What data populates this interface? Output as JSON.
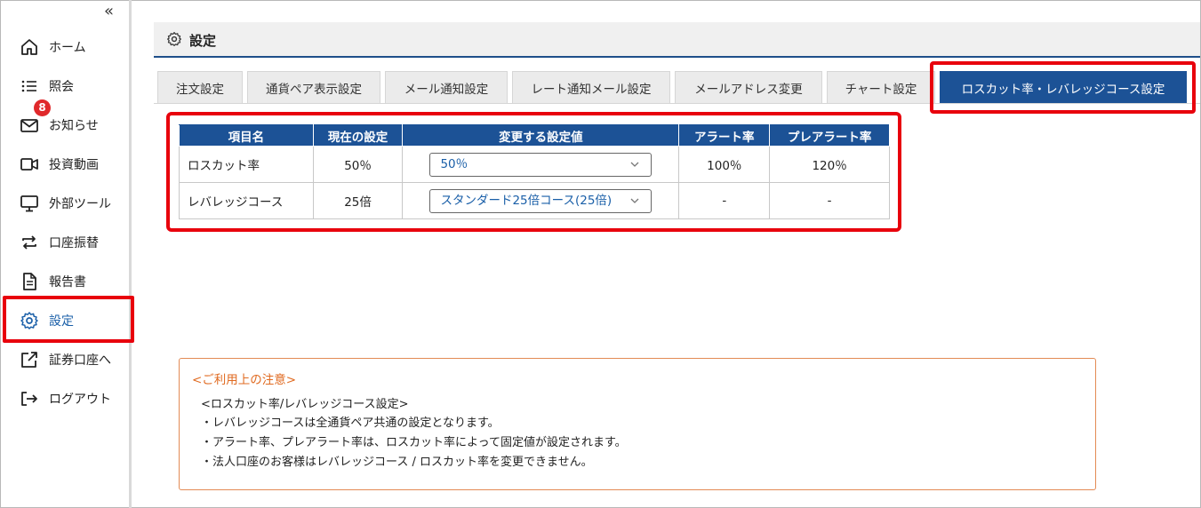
{
  "sidebar": {
    "collapse_icon": "double-chevron-left",
    "items": [
      {
        "label": "ホーム",
        "icon": "home-icon"
      },
      {
        "label": "照会",
        "icon": "list-icon"
      },
      {
        "label": "お知らせ",
        "icon": "mail-icon",
        "badge": "8"
      },
      {
        "label": "投資動画",
        "icon": "video-icon"
      },
      {
        "label": "外部ツール",
        "icon": "monitor-icon"
      },
      {
        "label": "口座振替",
        "icon": "transfer-icon"
      },
      {
        "label": "報告書",
        "icon": "document-icon"
      },
      {
        "label": "設定",
        "icon": "gear-icon",
        "active": true
      },
      {
        "label": "証券口座へ",
        "icon": "external-link-icon"
      },
      {
        "label": "ログアウト",
        "icon": "logout-icon"
      }
    ]
  },
  "page": {
    "title": "設定",
    "title_icon": "gear-icon"
  },
  "tabs": [
    {
      "label": "注文設定"
    },
    {
      "label": "通貨ペア表示設定"
    },
    {
      "label": "メール通知設定"
    },
    {
      "label": "レート通知メール設定"
    },
    {
      "label": "メールアドレス変更"
    },
    {
      "label": "チャート設定"
    },
    {
      "label": "ロスカット率・レバレッジコース設定",
      "active": true
    }
  ],
  "table": {
    "headers": [
      "項目名",
      "現在の設定",
      "変更する設定値",
      "アラート率",
      "プレアラート率"
    ],
    "rows": [
      {
        "name": "ロスカット率",
        "current": "50％",
        "select_value": "50％",
        "alert": "100％",
        "prealert": "120％"
      },
      {
        "name": "レバレッジコース",
        "current": "25倍",
        "select_value": "スタンダード25倍コース(25倍)",
        "alert": "-",
        "prealert": "-"
      }
    ]
  },
  "notice": {
    "title": "<ご利用上の注意>",
    "lines": [
      "<ロスカット率/レバレッジコース設定>",
      "・レバレッジコースは全通貨ペア共通の設定となります。",
      "・アラート率、プレアラート率は、ロスカット率によって固定値が設定されます。",
      "・法人口座のお客様はレバレッジコース / ロスカット率を変更できません。"
    ]
  },
  "colors": {
    "accent": "#1c5296",
    "highlight": "#e8000c",
    "badge": "#e0292b",
    "notice_border": "#e38b55"
  }
}
